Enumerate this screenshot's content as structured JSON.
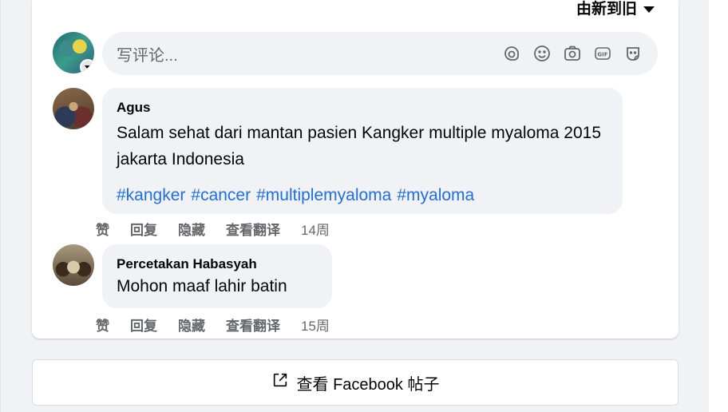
{
  "sort": {
    "label": "由新到旧"
  },
  "composer": {
    "placeholder": "写评论...",
    "icons": [
      "sticker-icon",
      "emoji-icon",
      "camera-icon",
      "gif-icon",
      "avatar-sticker-icon"
    ]
  },
  "comments": [
    {
      "author": "Agus",
      "text": "Salam sehat dari mantan pasien Kangker multiple myaloma 2015 jakarta Indonesia",
      "hashtags": [
        "#kangker",
        "#cancer",
        "#multiplemyaloma",
        "#myaloma"
      ],
      "actions": {
        "like": "赞",
        "reply": "回复",
        "hide": "隐藏",
        "translate": "查看翻译",
        "time": "14周"
      }
    },
    {
      "author": "Percetakan Habasyah",
      "text": "Mohon maaf lahir batin",
      "actions": {
        "like": "赞",
        "reply": "回复",
        "hide": "隐藏",
        "translate": "查看翻译",
        "time": "15周"
      }
    }
  ],
  "view_post": {
    "label": "查看 Facebook 帖子"
  },
  "colors": {
    "hashtag": "#216fdb",
    "bubble": "#f0f2f5",
    "muted": "#65676b"
  }
}
